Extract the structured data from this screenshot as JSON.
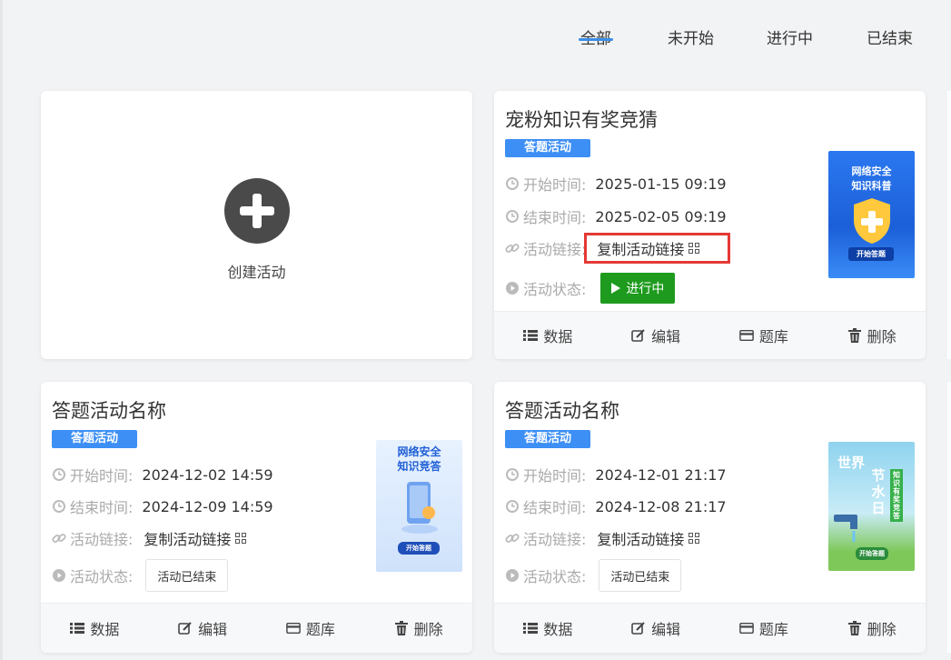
{
  "tabs": [
    {
      "label": "全部",
      "active": true
    },
    {
      "label": "未开始",
      "active": false
    },
    {
      "label": "进行中",
      "active": false
    },
    {
      "label": "已结束",
      "active": false
    }
  ],
  "create": {
    "label": "创建活动"
  },
  "labels": {
    "start": "开始时间:",
    "end": "结束时间:",
    "link": "活动链接:",
    "status": "活动状态:",
    "copy_link": "复制活动链接"
  },
  "footer": {
    "data": "数据",
    "edit": "编辑",
    "bank": "题库",
    "delete": "删除"
  },
  "cards": [
    {
      "title": "宠粉知识有奖竞猜",
      "badge": "答题活动",
      "start": "2025-01-15 09:19",
      "end": "2025-02-05 09:19",
      "status": "进行中",
      "poster": {
        "line1": "网络安全",
        "line2": "知识科普",
        "button": "开始答题"
      }
    },
    {
      "title": "答题活动名称",
      "badge": "答题活动",
      "start": "2024-12-02 14:59",
      "end": "2024-12-09 14:59",
      "status": "活动已结束",
      "poster": {
        "line1": "网络安全",
        "line2": "知识竞答",
        "button": "开始答题"
      }
    },
    {
      "title": "答题活动名称",
      "badge": "答题活动",
      "start": "2024-12-01 21:17",
      "end": "2024-12-08 21:17",
      "status": "活动已结束",
      "poster": {
        "line1": "世界",
        "line2": "节水日",
        "side": "知识有奖竞答",
        "button": "开始答题"
      }
    }
  ],
  "colors": {
    "accent": "#3a8ee6",
    "badge": "#3d8ff5",
    "running": "#1e9b1e",
    "highlight": "#e53935"
  }
}
